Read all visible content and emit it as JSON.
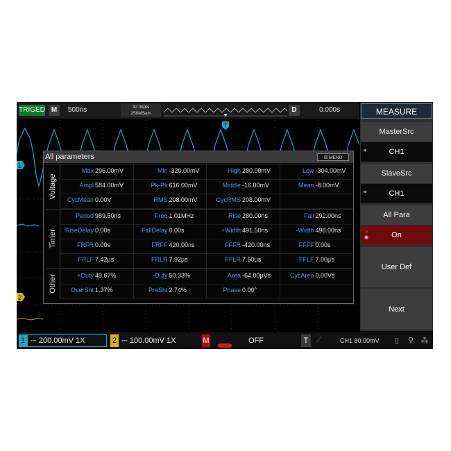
{
  "status": {
    "trig_state": "TRIGED",
    "mode_label": "M",
    "timebase": "500ns",
    "mem_depth": "32.0kpts",
    "sample_rate": "250MSa/s",
    "delay_label": "D",
    "delay": "0.000s"
  },
  "menu": {
    "title": "MEASURE",
    "master_src_label": "MasterSrc",
    "master_src_value": "CH1",
    "slave_src_label": "SlaveSrc",
    "slave_src_value": "CH1",
    "all_para_label": "All Para",
    "all_para_value": "On",
    "user_def_label": "User Def",
    "next_label": "Next"
  },
  "markers": {
    "ch1": "1",
    "ch2": "2",
    "trigger": "T"
  },
  "panel": {
    "title": "All parameters",
    "menu_button": "MENU",
    "groups": [
      {
        "label": "Voltage",
        "rows": [
          [
            [
              "Max",
              "296.00mV"
            ],
            [
              "Min",
              "-320.00mV"
            ],
            [
              "High",
              "280.00mV"
            ],
            [
              "Low",
              "-304.00mV"
            ]
          ],
          [
            [
              "Ampl",
              "584.00mV"
            ],
            [
              "Pk-Pk",
              "616.00mV"
            ],
            [
              "Middle",
              "-16.00mV"
            ],
            [
              "Mean",
              "-8.00mV"
            ]
          ],
          [
            [
              "CycMean",
              "0.00V"
            ],
            [
              "RMS",
              "208.00mV"
            ],
            [
              "CycRMS",
              "208.00mV"
            ],
            [
              "",
              ""
            ]
          ]
        ]
      },
      {
        "label": "Timer",
        "rows": [
          [
            [
              "Period",
              "989.50ns"
            ],
            [
              "Freq",
              "1.01MHz"
            ],
            [
              "Rise",
              "280.00ns"
            ],
            [
              "Fall",
              "292.00ns"
            ]
          ],
          [
            [
              "RiseDelay",
              "0.00s"
            ],
            [
              "FallDelay",
              "0.00s"
            ],
            [
              "+Width",
              "491.50ns"
            ],
            [
              "-Width",
              "498.00ns"
            ]
          ],
          [
            [
              "FRFR",
              "0.00s"
            ],
            [
              "FRFF",
              "420.00ns"
            ],
            [
              "FFFR",
              "-420.00ns"
            ],
            [
              "FFFF",
              "0.00s"
            ]
          ],
          [
            [
              "FRLF",
              "7.42µs"
            ],
            [
              "FRLR",
              "7.92µs"
            ],
            [
              "FFLR",
              "7.50µs"
            ],
            [
              "FFLF",
              "7.00µs"
            ]
          ]
        ]
      },
      {
        "label": "Other",
        "rows": [
          [
            [
              "+Duty",
              "49.67%"
            ],
            [
              "-Duty",
              "50.33%"
            ],
            [
              "Area",
              "-64.00µVs"
            ],
            [
              "CycArea",
              "0.00Vs"
            ]
          ],
          [
            [
              "OverSht",
              "1.37%"
            ],
            [
              "PreSht",
              "2.74%"
            ],
            [
              "Phase",
              "0.00°"
            ],
            [
              "",
              ""
            ]
          ]
        ]
      }
    ]
  },
  "bottom": {
    "ch1_num": "1",
    "ch1_scale": "200.00mV",
    "ch1_probe": "1X",
    "ch2_num": "2",
    "ch2_scale": "100.00mV",
    "ch2_probe": "1X",
    "math_label": "M",
    "math_state": "OFF",
    "trig_label": "T",
    "trig_info": "CH1 80.00mV"
  },
  "colors": {
    "ch1": "#19a5c8",
    "ch2": "#d8b400",
    "menu_active": "#6e0c0c",
    "param_name": "#5a8fd0"
  },
  "icons": {
    "coupling": "dc-coupling-icon",
    "slope": "rising-edge-icon",
    "usb": "usb-icon",
    "lan": "network-icon"
  }
}
